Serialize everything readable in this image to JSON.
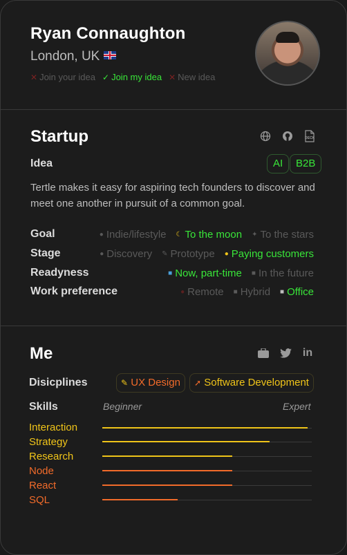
{
  "profile": {
    "name": "Ryan Connaughton",
    "location": "London, UK",
    "intents": [
      {
        "label": "Join your idea",
        "active": false
      },
      {
        "label": "Join my idea",
        "active": true
      },
      {
        "label": "New idea",
        "active": false
      }
    ]
  },
  "startup": {
    "title": "Startup",
    "icons": [
      "globe-icon",
      "github-icon",
      "deck-icon"
    ],
    "deck_icon_text": "DECK",
    "idea_label": "Idea",
    "idea_tags": [
      "AI",
      "B2B"
    ],
    "description": "Tertle makes it easy for aspiring tech founders to discover and meet one another in pursuit of a common goal.",
    "attributes": [
      {
        "label": "Goal",
        "options": [
          {
            "label": "Indie/lifestyle",
            "selected": false
          },
          {
            "label": "To the moon",
            "selected": true
          },
          {
            "label": "To the stars",
            "selected": false
          }
        ]
      },
      {
        "label": "Stage",
        "options": [
          {
            "label": "Discovery",
            "selected": false
          },
          {
            "label": "Prototype",
            "selected": false
          },
          {
            "label": "Paying customers",
            "selected": true
          }
        ]
      },
      {
        "label": "Readyness",
        "options": [
          {
            "label": "Now, part-time",
            "selected": true
          },
          {
            "label": "In the future",
            "selected": false
          }
        ]
      },
      {
        "label": "Work preference",
        "options": [
          {
            "label": "Remote",
            "selected": false
          },
          {
            "label": "Hybrid",
            "selected": false
          },
          {
            "label": "Office",
            "selected": true
          }
        ]
      }
    ]
  },
  "me": {
    "title": "Me",
    "icons": [
      "portfolio-icon",
      "twitter-icon",
      "linkedin-icon"
    ],
    "linkedin_text": "in",
    "disciplines_label": "Disicplines",
    "disciplines": [
      "UX Design",
      "Software Development"
    ],
    "skills_label": "Skills",
    "scale_min": "Beginner",
    "scale_max": "Expert",
    "skills": [
      {
        "name": "Interaction",
        "level": 0.98,
        "color": "#f0c419"
      },
      {
        "name": "Strategy",
        "level": 0.8,
        "color": "#f0c419"
      },
      {
        "name": "Research",
        "level": 0.62,
        "color": "#f0c419"
      },
      {
        "name": "Node",
        "level": 0.62,
        "color": "#f26b2a"
      },
      {
        "name": "React",
        "level": 0.62,
        "color": "#f26b2a"
      },
      {
        "name": "SQL",
        "level": 0.36,
        "color": "#f26b2a"
      }
    ]
  },
  "colors": {
    "accent_green": "#39e639",
    "accent_yellow": "#f0c419",
    "accent_orange": "#f26b2a"
  }
}
